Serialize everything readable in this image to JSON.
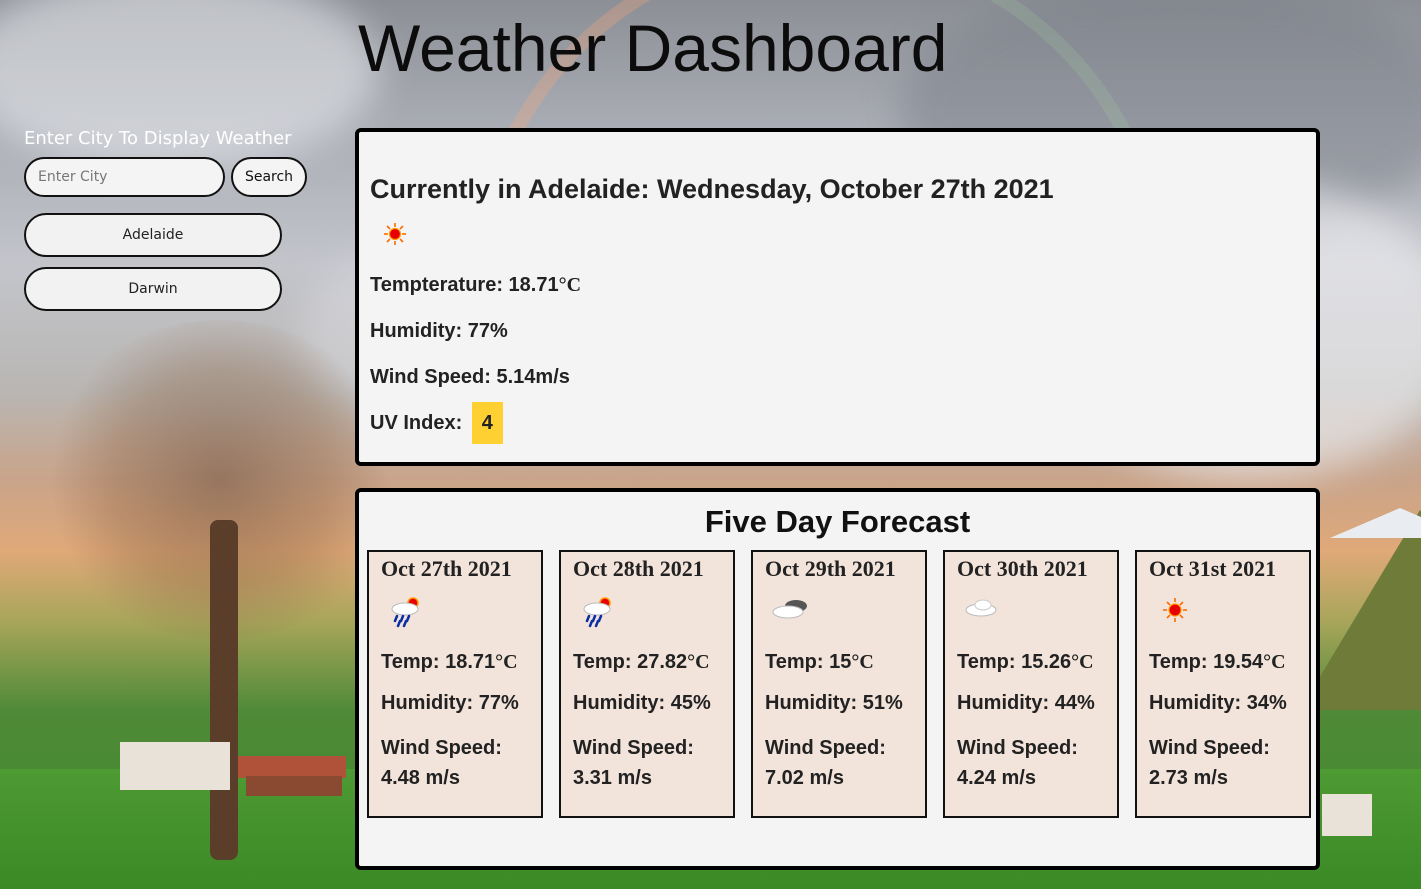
{
  "app": {
    "title": "Weather Dashboard"
  },
  "sidebar": {
    "heading": "Enter City To Display Weather",
    "search": {
      "placeholder": "Enter City",
      "value": "",
      "button_label": "Search"
    },
    "history": [
      {
        "label": "Adelaide"
      },
      {
        "label": "Darwin"
      }
    ]
  },
  "current": {
    "heading": "Currently in Adelaide: Wednesday, October 27th 2021",
    "icon": "sun-icon",
    "temp_label": "Tempterature: ",
    "temp_value": "18.71",
    "unit": "°C",
    "humidity": "Humidity: 77%",
    "wind": "Wind Speed: 5.14m/s",
    "uv_label": "UV Index: ",
    "uv_value": "4",
    "uv_color": "#ffd032"
  },
  "forecast": {
    "heading": "Five Day Forecast",
    "days": [
      {
        "date": "Oct 27th 2021",
        "icon": "rain-sun-icon",
        "temp_label": "Temp: ",
        "temp_value": "18.71",
        "unit": "°C",
        "humidity": "Humidity: 77%",
        "wind_label": "Wind Speed:",
        "wind_value": "4.48 m/s"
      },
      {
        "date": "Oct 28th 2021",
        "icon": "rain-sun-icon",
        "temp_label": "Temp: ",
        "temp_value": "27.82",
        "unit": "°C",
        "humidity": "Humidity: 45%",
        "wind_label": "Wind Speed:",
        "wind_value": "3.31 m/s"
      },
      {
        "date": "Oct 29th 2021",
        "icon": "cloudy-icon",
        "temp_label": "Temp: ",
        "temp_value": "15",
        "unit": "°C",
        "humidity": "Humidity: 51%",
        "wind_label": "Wind Speed:",
        "wind_value": "7.02 m/s"
      },
      {
        "date": "Oct 30th 2021",
        "icon": "cloud-icon",
        "temp_label": "Temp: ",
        "temp_value": "15.26",
        "unit": "°C",
        "humidity": "Humidity: 44%",
        "wind_label": "Wind Speed:",
        "wind_value": "4.24 m/s"
      },
      {
        "date": "Oct 31st 2021",
        "icon": "sun-icon",
        "temp_label": "Temp: ",
        "temp_value": "19.54",
        "unit": "°C",
        "humidity": "Humidity: 34%",
        "wind_label": "Wind Speed:",
        "wind_value": "2.73 m/s"
      }
    ]
  }
}
